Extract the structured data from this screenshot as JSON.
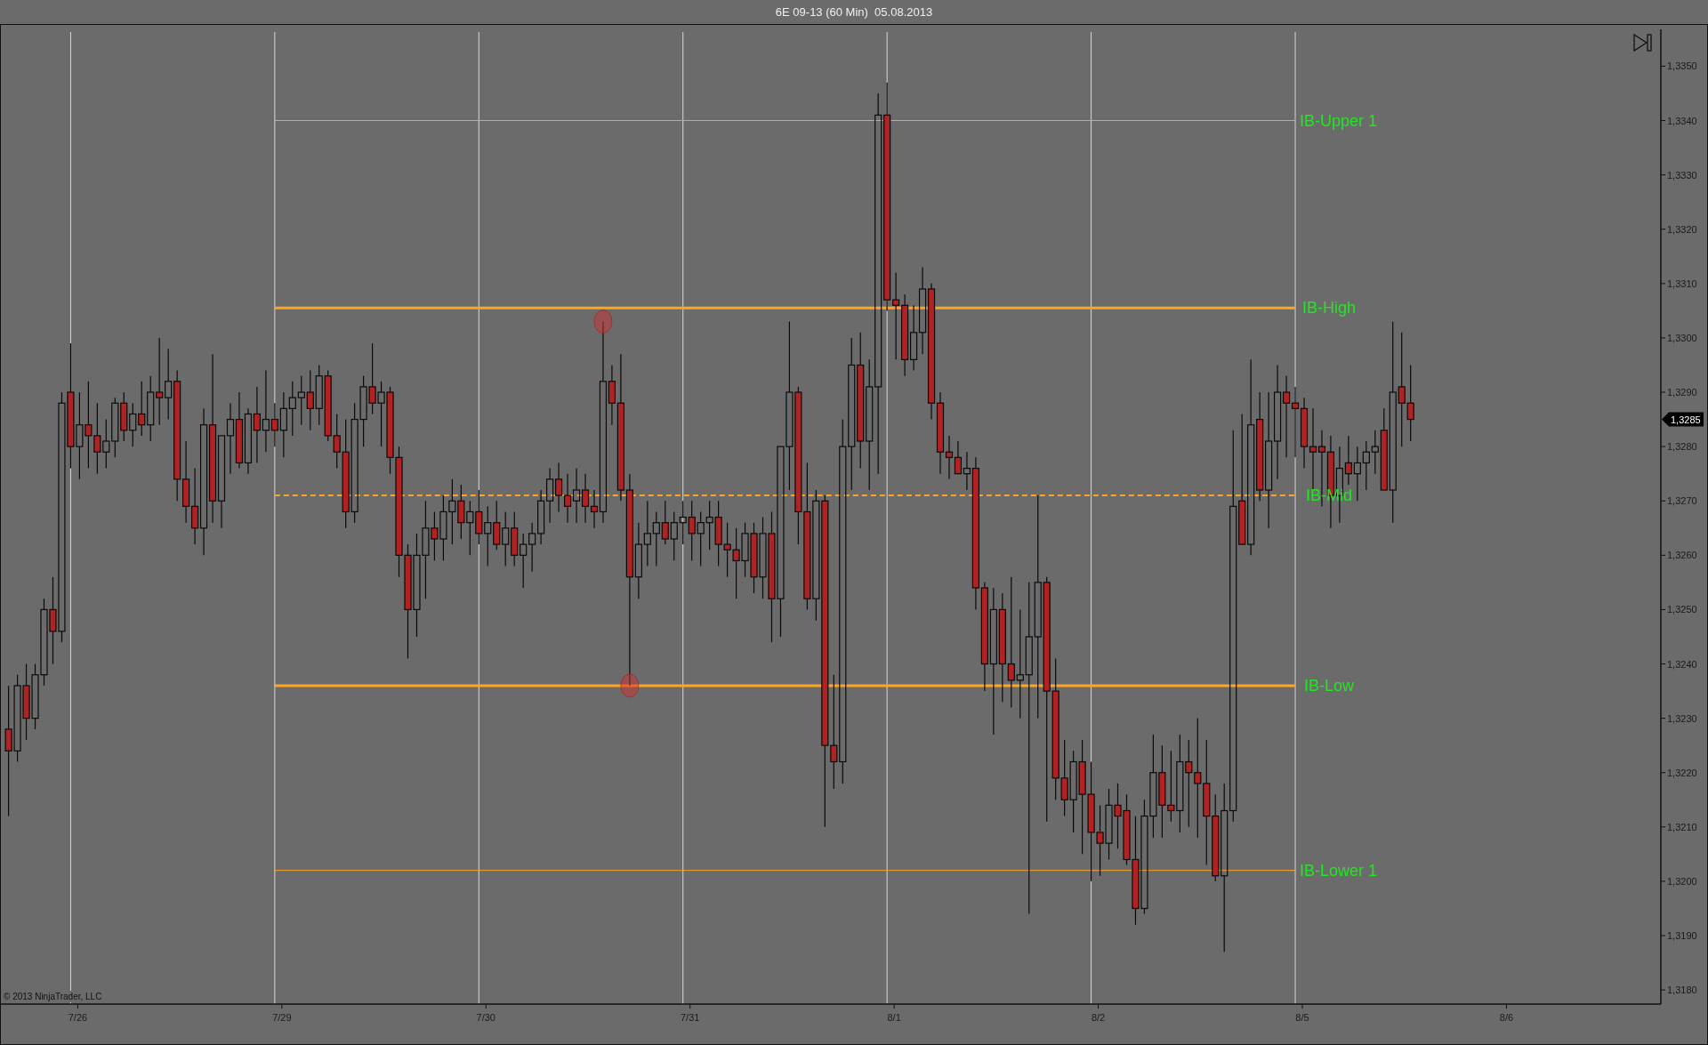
{
  "window": {
    "title": "6E 09-13 (60 Min)  05.08.2013"
  },
  "chart": {
    "price_labels": [
      "1,3350",
      "1,3340",
      "1,3330",
      "1,3320",
      "1,3310",
      "1,3300",
      "1,3290",
      "1,3280",
      "1,3270",
      "1,3260",
      "1,3250",
      "1,3240",
      "1,3230",
      "1,3220",
      "1,3210",
      "1,3200",
      "1,3190",
      "1,3180"
    ],
    "date_labels": [
      "7/26",
      "7/29",
      "7/30",
      "7/31",
      "8/1",
      "8/2",
      "8/5",
      "8/6"
    ],
    "level_labels": [
      "IB-Upper 1",
      "IB-High",
      "IB-Mid",
      "IB-Low",
      "IB-Lower 1"
    ],
    "last_price": "1,3285",
    "copyright": "© 2013 NinjaTrader, LLC"
  }
}
